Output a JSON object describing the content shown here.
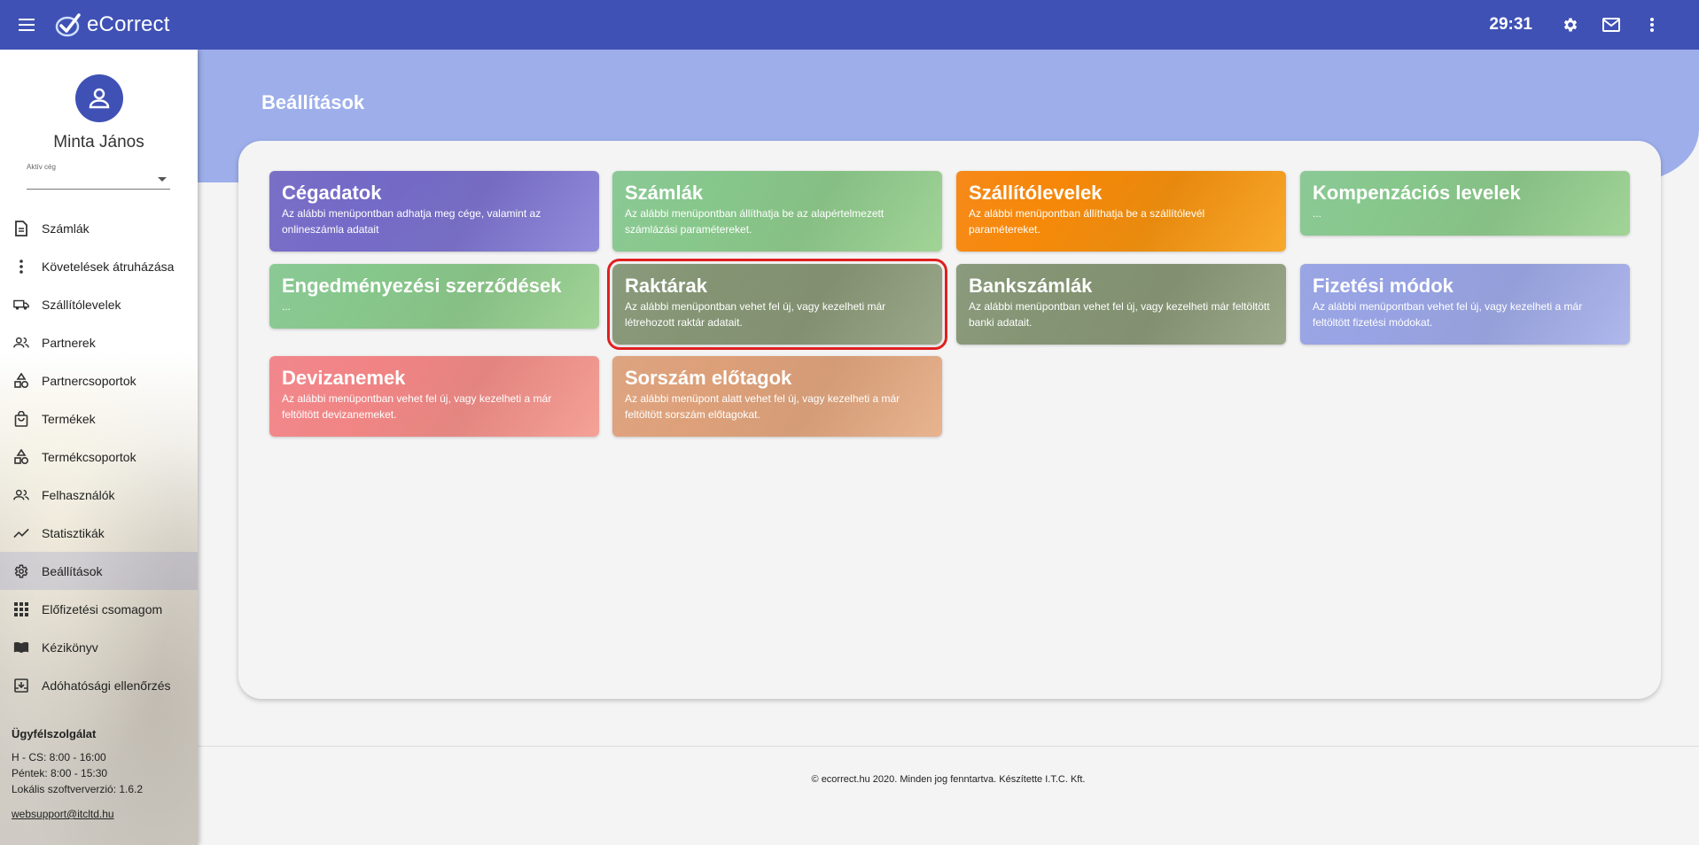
{
  "app": {
    "title": "eCorrect",
    "timer": "29:31"
  },
  "user": {
    "name": "Minta János",
    "company_label": "Aktív cég",
    "company_value": ""
  },
  "sidebar": {
    "items": [
      {
        "label": "Számlák",
        "icon": "document-icon",
        "active": false
      },
      {
        "label": "Követelések átruházása",
        "icon": "more-vert-icon",
        "active": false
      },
      {
        "label": "Szállítólevelek",
        "icon": "truck-icon",
        "active": false
      },
      {
        "label": "Partnerek",
        "icon": "people-icon",
        "active": false
      },
      {
        "label": "Partnercsoportok",
        "icon": "category-icon",
        "active": false
      },
      {
        "label": "Termékek",
        "icon": "shopping-bag-icon",
        "active": false
      },
      {
        "label": "Termékcsoportok",
        "icon": "category-icon",
        "active": false
      },
      {
        "label": "Felhasználók",
        "icon": "people-icon",
        "active": false
      },
      {
        "label": "Statisztikák",
        "icon": "trending-icon",
        "active": false
      },
      {
        "label": "Beállítások",
        "icon": "gear-icon",
        "active": true
      },
      {
        "label": "Előfizetési csomagom",
        "icon": "grid-icon",
        "active": false
      },
      {
        "label": "Kézikönyv",
        "icon": "book-icon",
        "active": false
      },
      {
        "label": "Adóhatósági ellenőrzés",
        "icon": "archive-icon",
        "active": false
      }
    ]
  },
  "support": {
    "title": "Ügyfélszolgálat",
    "hours_1": "H - CS: 8:00 - 16:00",
    "hours_2": "Péntek: 8:00 - 15:30",
    "version": "Lokális szoftververzió: 1.6.2",
    "email": "websupport@itcltd.hu"
  },
  "page": {
    "title": "Beállítások"
  },
  "tiles": [
    {
      "title": "Cégadatok",
      "desc": "Az alábbi menüpontban adhatja meg cége, valamint az onlineszámla adatait",
      "color1": "#6a5fc0",
      "color2": "#8a82d8"
    },
    {
      "title": "Számlák",
      "desc": "Az alábbi menüpontban állíthatja be az alapértelmezett számlázási paramétereket.",
      "color1": "#7ec38a",
      "color2": "#9ad08e"
    },
    {
      "title": "Szállítólevelek",
      "desc": "Az alábbi menüpontban állíthatja be a szállítólevél paramétereket.",
      "color1": "#f57c00",
      "color2": "#f7a21a"
    },
    {
      "title": "Kompenzációs levelek",
      "desc": "...",
      "color1": "#7ec38a",
      "color2": "#9ad08e"
    },
    {
      "title": "Engedményezési szerződések",
      "desc": "...",
      "color1": "#7ec38a",
      "color2": "#9ad08e"
    },
    {
      "title": "Raktárak",
      "desc": "Az alábbi menüpontban vehet fel új, vagy kezelheti már létrehozott raktár adatait.",
      "color1": "#7d8f6e",
      "color2": "#93a07f"
    },
    {
      "title": "Bankszámlák",
      "desc": "Az alábbi menüpontban vehet fel új, vagy kezelheti már feltöltött banki adatait.",
      "color1": "#7d8f6e",
      "color2": "#93a07f"
    },
    {
      "title": "Fizetési módok",
      "desc": "Az alábbi menüpontban vehet fel új, vagy kezelheti a már feltöltött fizetési módokat.",
      "color1": "#8e9be0",
      "color2": "#a9b2ea"
    },
    {
      "title": "Devizanemek",
      "desc": "Az alábbi menüpontban vehet fel új, vagy kezelheti a már feltöltött devizanemeket.",
      "color1": "#f07a80",
      "color2": "#f39a8e"
    },
    {
      "title": "Sorszám előtagok",
      "desc": "Az alábbi menüpont alatt vehet fel új, vagy kezelheti a már feltöltött sorszám előtagokat.",
      "color1": "#d99a73",
      "color2": "#e6ad86"
    }
  ],
  "footer": {
    "text": "© ecorrect.hu 2020. Minden jog fenntartva. Készítette I.T.C. Kft."
  }
}
